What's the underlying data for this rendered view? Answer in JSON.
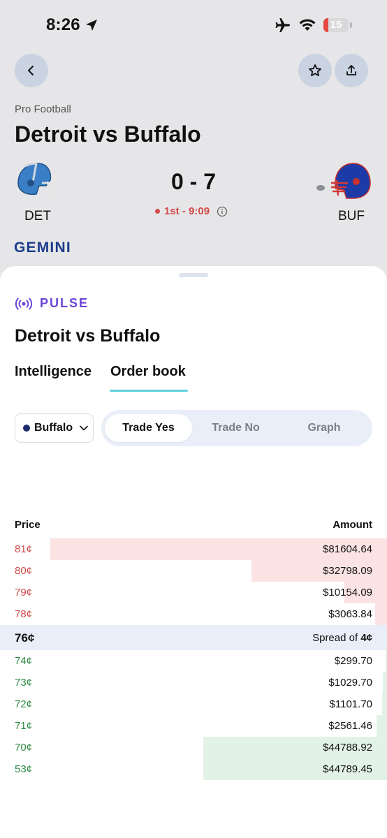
{
  "status_bar": {
    "time": "8:26",
    "battery": "15"
  },
  "header": {
    "league": "Pro Football",
    "title": "Detroit vs Buffalo",
    "brand": "GEMINI"
  },
  "game": {
    "home": {
      "code": "DET",
      "color": "#3a7fc6"
    },
    "away": {
      "code": "BUF",
      "color": "#1c3ba6"
    },
    "score": "0 - 7",
    "clock": "1st - 9:09"
  },
  "sheet": {
    "pulse_label": "PULSE",
    "title": "Detroit vs Buffalo",
    "tabs": [
      {
        "label": "Intelligence",
        "active": false
      },
      {
        "label": "Order book",
        "active": true
      }
    ],
    "team_select": {
      "value": "Buffalo"
    },
    "segments": [
      {
        "label": "Trade Yes",
        "active": true
      },
      {
        "label": "Trade No",
        "active": false
      },
      {
        "label": "Graph",
        "active": false
      }
    ]
  },
  "order_book": {
    "price_header": "Price",
    "amount_header": "Amount",
    "asks": [
      {
        "price": "81¢",
        "amount": "$81604.64",
        "depth_fraction": 0.87
      },
      {
        "price": "80¢",
        "amount": "$32798.09",
        "depth_fraction": 0.35
      },
      {
        "price": "79¢",
        "amount": "$10154.09",
        "depth_fraction": 0.11
      },
      {
        "price": "78¢",
        "amount": "$3063.84",
        "depth_fraction": 0.03
      }
    ],
    "spread": {
      "price": "76¢",
      "label": "Spread of",
      "value": "4¢"
    },
    "bids": [
      {
        "price": "74¢",
        "amount": "$299.70",
        "depth_fraction": 0.003
      },
      {
        "price": "73¢",
        "amount": "$1029.70",
        "depth_fraction": 0.011
      },
      {
        "price": "72¢",
        "amount": "$1101.70",
        "depth_fraction": 0.012
      },
      {
        "price": "71¢",
        "amount": "$2561.46",
        "depth_fraction": 0.027
      },
      {
        "price": "70¢",
        "amount": "$44788.92",
        "depth_fraction": 0.475
      },
      {
        "price": "53¢",
        "amount": "$44789.45",
        "depth_fraction": 0.475
      }
    ]
  }
}
